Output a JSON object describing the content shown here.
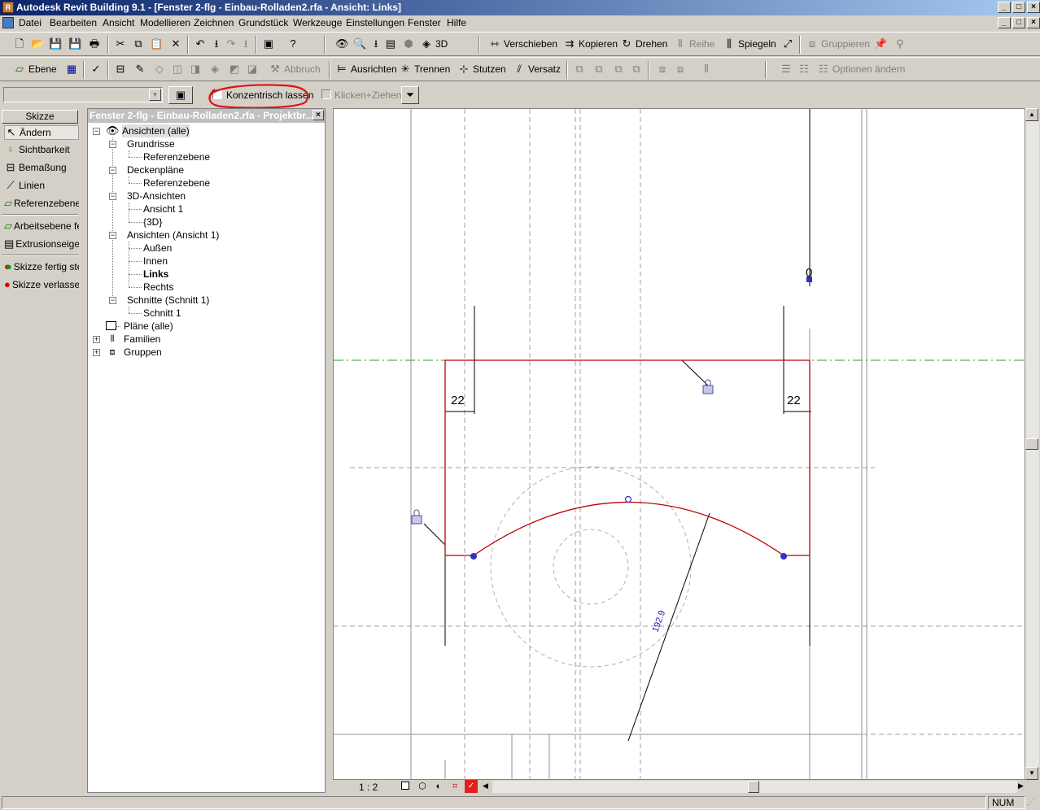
{
  "window": {
    "title": "Autodesk Revit Building 9.1 - [Fenster 2-flg - Einbau-Rolladen2.rfa - Ansicht: Links]",
    "min": "_",
    "max": "□",
    "close": "×"
  },
  "menu": [
    "Datei",
    "Bearbeiten",
    "Ansicht",
    "Modellieren",
    "Zeichnen",
    "Grundstück",
    "Werkzeuge",
    "Einstellungen",
    "Fenster",
    "Hilfe"
  ],
  "toolbar1": {
    "three_d": "3D",
    "verschieben": "Verschieben",
    "kopieren": "Kopieren",
    "drehen": "Drehen",
    "reihe": "Reihe",
    "spiegeln": "Spiegeln",
    "gruppieren": "Gruppieren"
  },
  "toolbar2": {
    "ebene": "Ebene",
    "abbruch": "Abbruch",
    "ausrichten": "Ausrichten",
    "trennen": "Trennen",
    "stutzen": "Stutzen",
    "versatz": "Versatz",
    "optionen": "Optionen ändern"
  },
  "options": {
    "combo_value": "",
    "konzentrisch": "Konzentrisch lassen",
    "klicken": "Klicken+Ziehen"
  },
  "sketch": {
    "header": "Skizze",
    "items": [
      "Ändern",
      "Sichtbarkeit",
      "Bemaßung",
      "Linien",
      "Referenzebene",
      "Arbeitsebene fe",
      "Extrusionseiger",
      "Skizze fertig ste",
      "Skizze verlasser"
    ]
  },
  "browser": {
    "caption": "Fenster 2-flg - Einbau-Rolladen2.rfa - Projektbr...",
    "close": "×",
    "tree": {
      "root": "Ansichten (alle)",
      "grundrisse": "Grundrisse",
      "g_ref": "Referenzebene",
      "deckenplaene": "Deckenpläne",
      "d_ref": "Referenzebene",
      "ansichten3d": "3D-Ansichten",
      "ansicht1": "Ansicht 1",
      "a3d": "{3D}",
      "ansichten": "Ansichten (Ansicht 1)",
      "aussen": "Außen",
      "innen": "Innen",
      "links": "Links",
      "rechts": "Rechts",
      "schnitte": "Schnitte (Schnitt 1)",
      "schnitt1": "Schnitt 1",
      "plaene": "Pläne (alle)",
      "familien": "Familien",
      "gruppen": "Gruppen"
    }
  },
  "drawing": {
    "dim_left": "22",
    "dim_right": "22",
    "dim_top": "0",
    "radius": "192.9",
    "sketch_color": "#c00000",
    "reference_color": "#00a000"
  },
  "viewbar": {
    "scale": "1 : 2"
  },
  "status": {
    "text": "",
    "num": "NUM"
  }
}
